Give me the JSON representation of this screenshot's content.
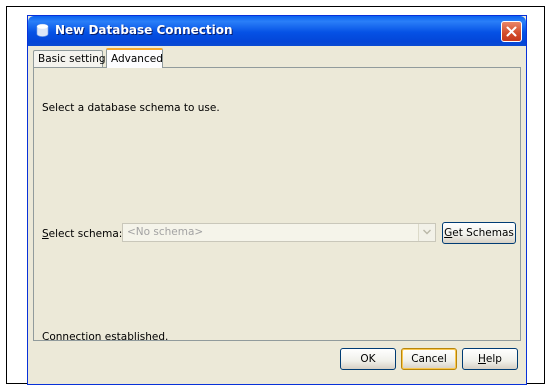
{
  "window": {
    "title": "New Database Connection"
  },
  "tabs": [
    {
      "label": "Basic setting"
    },
    {
      "label": "Advanced"
    }
  ],
  "advanced": {
    "intro": "Select a database schema to use.",
    "schema_label_mnemonic": "S",
    "schema_label_rest": "elect schema:",
    "schema_value": "<No schema>",
    "get_schemas_mnemonic": "G",
    "get_schemas_rest": "et Schemas",
    "status": "Connection established."
  },
  "buttons": {
    "ok": "OK",
    "cancel": "Cancel",
    "help_mnemonic": "H",
    "help_rest": "elp"
  },
  "colors": {
    "titlebar": "#0551e5",
    "close": "#d34c2a",
    "dialog_bg": "#ece9d8",
    "active_tab_accent": "#f4a92d"
  },
  "icons": {
    "app": "database-icon",
    "close": "close-icon",
    "dropdown": "chevron-down-icon"
  }
}
